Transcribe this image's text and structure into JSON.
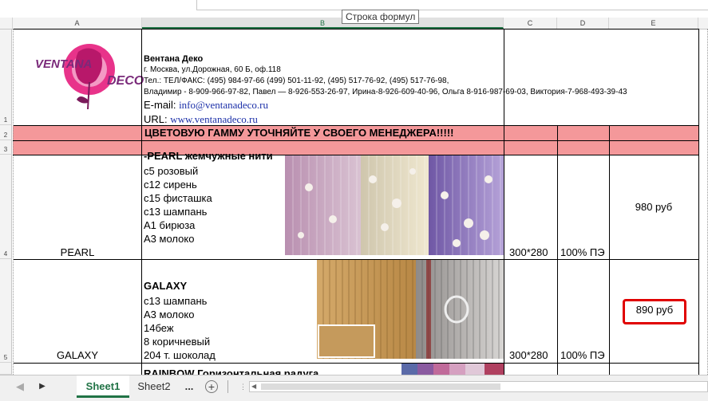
{
  "formula_bar": {
    "tooltip": "Строка формул"
  },
  "columns": [
    "A",
    "B",
    "C",
    "D",
    "E"
  ],
  "rows": [
    "1",
    "2",
    "3",
    "4",
    "5"
  ],
  "company": {
    "name": "Вентана Деко",
    "address": "г. Москва, ул.Дорожная, 60 Б, оф.118",
    "phones": "Тел.: ТЕЛ/ФАКС: (495) 984-97-66     (499) 501-11-92, (495) 517-76-92, (495) 517-76-98,",
    "managers": "Владимир - 8-909-966-97-82, Павел — 8-926-553-26-97, Ирина-8-926-609-40-96, Ольга 8-916-987-69-03, Виктория-7-968-493-39-43",
    "email_label": "E-mail: ",
    "email": "info@ventanadeco.ru",
    "url_label": "URL: ",
    "url": "www.ventanadeco.ru"
  },
  "logo": {
    "text1": "VENTANA",
    "text2": "DECO"
  },
  "banner": "ЦВЕТОВУЮ ГАММУ УТОЧНЯЙТЕ У  СВОЕГО    МЕНЕДЖЕРА!!!!!",
  "products": [
    {
      "name": "PEARL",
      "title": "-PEARL жемчужные нити",
      "lines": [
        "с5 розовый",
        "с12 сирень",
        "с15 фисташка",
        "с13 шампань",
        "А1 бирюза",
        "А3 молоко"
      ],
      "size": "300*280",
      "material": "100% ПЭ",
      "price": "980 руб"
    },
    {
      "name": "GALAXY",
      "title": "GALAXY",
      "lines": [
        "с13 шампань",
        "А3 молоко",
        "14беж",
        "8 коричневый",
        "204 т. шоколад"
      ],
      "size": "300*280",
      "material": "100% ПЭ",
      "price": "890 руб"
    },
    {
      "title": "RAINBOW Горизонтальная радуга"
    }
  ],
  "sheets": {
    "tab1": "Sheet1",
    "tab2": "Sheet2",
    "more": "...",
    "add": "+"
  },
  "colors": {
    "pink_fill": "#f4989a",
    "accent": "#217346",
    "highlight": "#e00000"
  }
}
